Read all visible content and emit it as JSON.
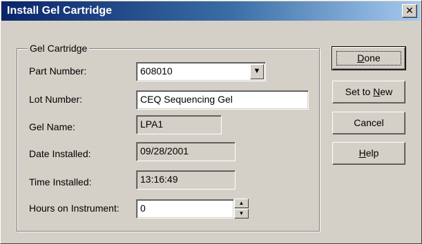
{
  "window": {
    "title": "Install Gel Cartridge",
    "close_glyph": "✕"
  },
  "group": {
    "label": "Gel Cartridge"
  },
  "fields": {
    "part_number": {
      "label": "Part Number:",
      "value": "608010"
    },
    "lot_number": {
      "label": "Lot Number:",
      "value": "CEQ Sequencing Gel"
    },
    "gel_name": {
      "label": "Gel Name:",
      "value": "LPA1"
    },
    "date_installed": {
      "label": "Date Installed:",
      "value": "09/28/2001"
    },
    "time_installed": {
      "label": "Time Installed:",
      "value": "13:16:49"
    },
    "hours_on_instrument": {
      "label": "Hours on Instrument:",
      "value": "0"
    }
  },
  "buttons": {
    "done": {
      "pre": "",
      "mn": "D",
      "post": "one"
    },
    "set_to_new": {
      "pre": "Set to ",
      "mn": "N",
      "post": "ew"
    },
    "cancel": {
      "label": "Cancel"
    },
    "help": {
      "pre": "",
      "mn": "H",
      "post": "elp"
    }
  },
  "icons": {
    "dropdown": "chevron-down-icon",
    "spin_up": "arrow-up-icon",
    "spin_down": "arrow-down-icon",
    "close": "close-icon"
  }
}
